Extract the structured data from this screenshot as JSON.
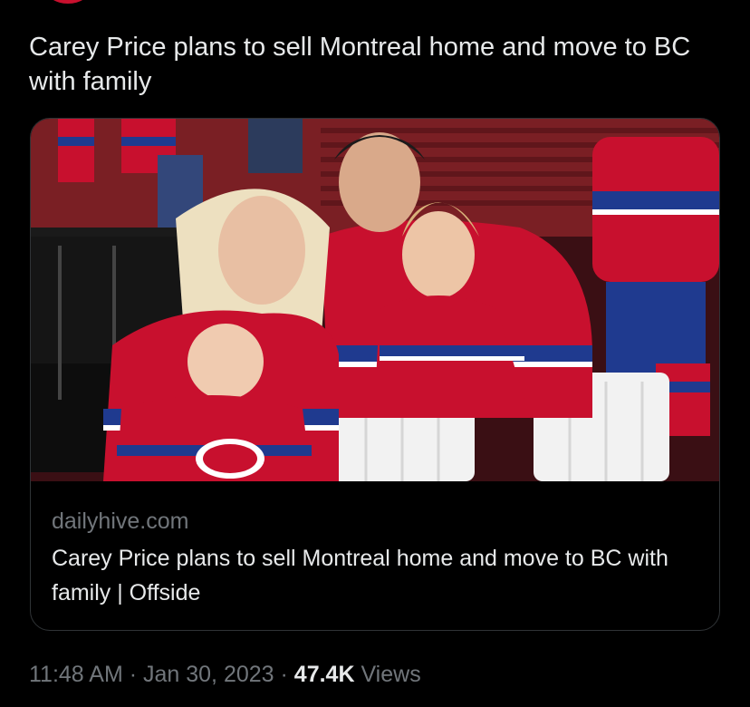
{
  "tweet": {
    "text": "Carey Price plans to sell Montreal home and move to BC with family"
  },
  "card": {
    "image": "photo-family-in-red-hockey-jerseys-at-arena",
    "domain": "dailyhive.com",
    "title": "Carey Price plans to sell Montreal home and move to BC with family | Offside"
  },
  "meta": {
    "time": "11:48 AM",
    "separator1": " · ",
    "date": "Jan 30, 2023",
    "separator2": " · ",
    "views_count": "47.4K",
    "views_label": " Views"
  },
  "colors": {
    "background": "#000000",
    "text": "#e7e9ea",
    "secondary_text": "#71767b",
    "card_border": "#2f3336",
    "jersey_red": "#c8102e",
    "jersey_blue": "#1f3a8f"
  }
}
